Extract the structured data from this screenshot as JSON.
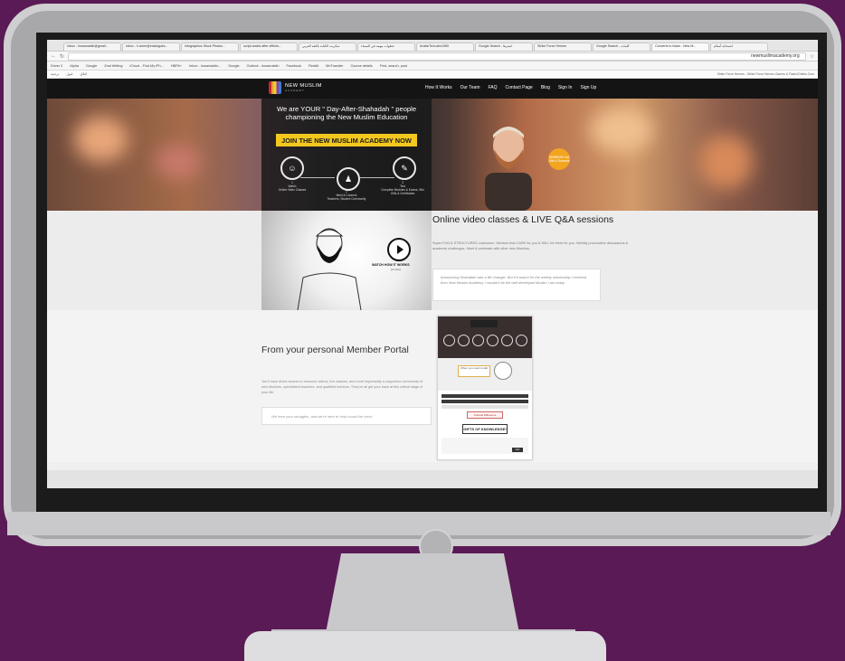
{
  "browser": {
    "tabs": [
      "Inbox - husamaldin@gmail...",
      "Inbox - h.amer@edalogues...",
      "Infographics Stock Photos...",
      "script arabic after effects...",
      "سكربت الكتابة باللغة العربي",
      "خطوات مهمة في السماء",
      "ArabicText-abn1969",
      "Google Search - انشرها",
      "Strike Force Heroes",
      "Google Search - كلمات",
      "Converts to Islam - New M...",
      "انصحابة أسلام"
    ],
    "url": "newmuslimacademy.org",
    "bookmarks": [
      "Driver 2",
      "Alpha",
      "Google",
      "Zeal Writing",
      "iCloud - Find My iPh...",
      "HBPA+",
      "Inbox - husamaldin...",
      "Google",
      "Outlook - husamaldin",
      "Facebook",
      "Reddit",
      "MeTransfer",
      "Course details",
      "Find, search, post"
    ],
    "tooltip": "Strike Force Heroes - Strike Force Heroes Games & Flash4Online.Com",
    "infobar": [
      "ترجمة",
      "قبول",
      "اغلاق"
    ]
  },
  "site": {
    "logo": {
      "name": "NEW MUSLIM",
      "sub": "ACADEMY"
    },
    "menu": [
      "How It Works",
      "Our Team",
      "FAQ",
      "Contact Page",
      "Blog",
      "Sign In",
      "Sign Up"
    ],
    "hero": {
      "title_line1": "We are YOUR \" Day-After-Shahadah \" people",
      "title_line2": "championing the New Muslim Education",
      "cta": "JOIN THE NEW MUSLIM ACADEMY NOW",
      "steps": [
        {
          "num": "1",
          "title": "Watch",
          "desc": "Online Video Classes"
        },
        {
          "num": "2",
          "title": "Meet & Connect",
          "desc": "Teachers, Student Community"
        },
        {
          "num": "3",
          "title": "Test",
          "desc": "Complete Modules & Exams, Win Gifts & Certificates"
        }
      ],
      "badge": "MEMBERS Get Gifts & Rewards"
    },
    "section2": {
      "title": "Online video classes & LIVE Q&A sessions",
      "text": "Super FUN & STRUCTURED curriculum. Mentors that CARE for you & WILL be there for you. Weekly provocative discussions & academic challenges. Meet & celebrate with other new Muslims.",
      "quote": "Announcing Shahadah was a life changer. But if it wasn't for the weekly mentorship I received from New Muslim Academy, I wouldn't be the well developed Muslim I am today.",
      "watch_label": "WATCH HOW IT WORKS",
      "watch_sub": "(2 mins)"
    },
    "section3": {
      "title": "From your personal Member Portal",
      "text": "You'll have direct access to resource videos, live classes, and more importantly a supportive community of new Muslims, specialised teachers, and qualified mentors. They've all got your back at this critical stage of your life.",
      "quote": "We hear your struggles, and we're here to help round the clock.",
      "phone": {
        "box_text": "When you need to talk",
        "btn_text": "Cultural Difference",
        "gift_text": "GIFTS OF KNOWLEDGE!",
        "ok": "GO"
      }
    }
  }
}
